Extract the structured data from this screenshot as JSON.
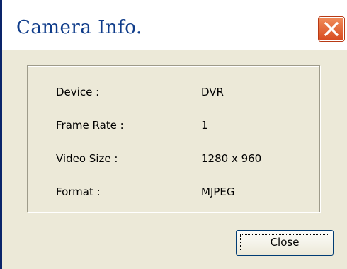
{
  "window": {
    "title": "Camera Info.",
    "close_icon": "close-icon"
  },
  "info": {
    "rows": [
      {
        "label": "Device :",
        "value": "DVR"
      },
      {
        "label": "Frame Rate :",
        "value": "1"
      },
      {
        "label": "Video Size :",
        "value": "1280 x 960"
      },
      {
        "label": "Format :",
        "value": "MJPEG"
      }
    ]
  },
  "buttons": {
    "close_label": "Close"
  },
  "colors": {
    "title_text": "#0f3c8a",
    "close_icon_bg": "#d74a1f",
    "dialog_bg": "#ece9d8"
  }
}
